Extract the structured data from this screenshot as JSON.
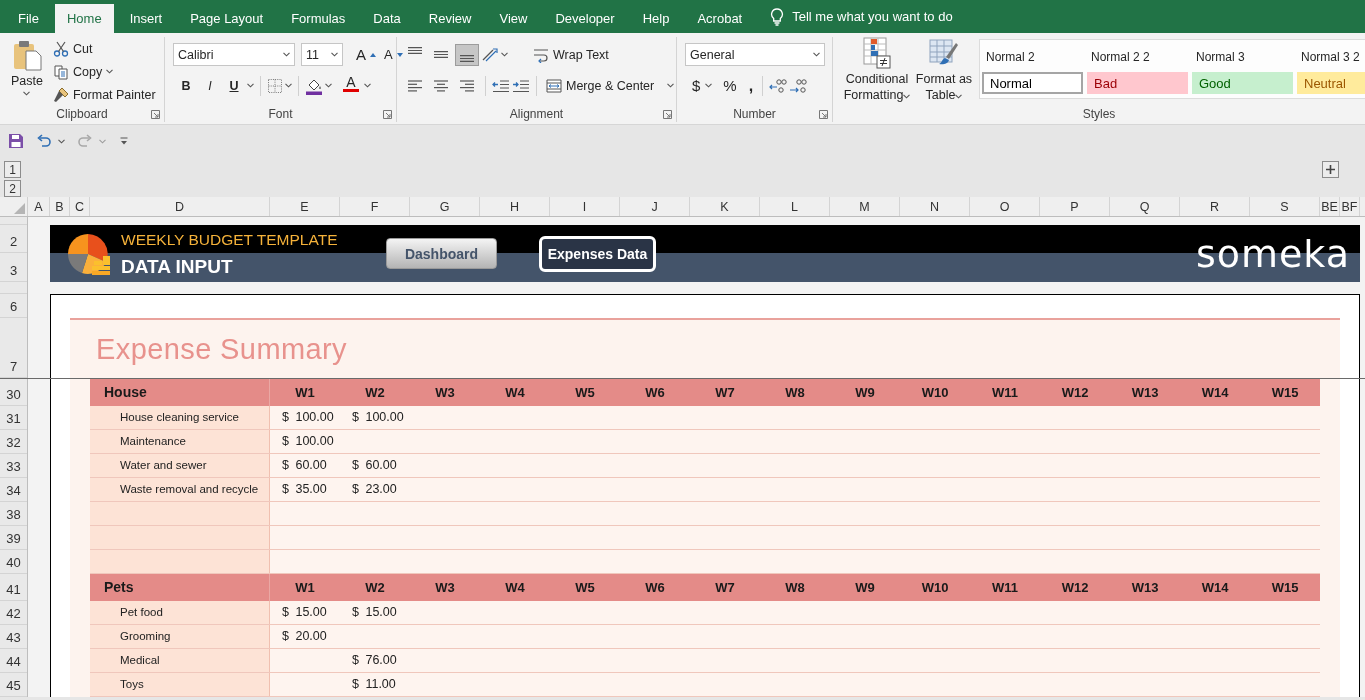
{
  "tabs": [
    {
      "label": "File",
      "selected": false
    },
    {
      "label": "Home",
      "selected": true
    },
    {
      "label": "Insert",
      "selected": false
    },
    {
      "label": "Page Layout",
      "selected": false
    },
    {
      "label": "Formulas",
      "selected": false
    },
    {
      "label": "Data",
      "selected": false
    },
    {
      "label": "Review",
      "selected": false
    },
    {
      "label": "View",
      "selected": false
    },
    {
      "label": "Developer",
      "selected": false
    },
    {
      "label": "Help",
      "selected": false
    },
    {
      "label": "Acrobat",
      "selected": false
    }
  ],
  "tell_me": {
    "placeholder": "Tell me what you want to do"
  },
  "clipboard": {
    "label": "Clipboard",
    "paste": "Paste",
    "cut": "Cut",
    "copy": "Copy",
    "format_painter": "Format Painter"
  },
  "font": {
    "label": "Font",
    "name": "Calibri",
    "size": "11",
    "grow": "A",
    "shrink": "A",
    "bold": "B",
    "italic": "I",
    "underline": "U",
    "font_color_button": "A"
  },
  "alignment": {
    "label": "Alignment",
    "vertical": [
      {
        "selected": false
      },
      {
        "selected": false
      },
      {
        "selected": true
      }
    ],
    "wrap_text": "Wrap Text",
    "merge_center": "Merge & Center"
  },
  "number": {
    "label": "Number",
    "format": "General",
    "currency": "$",
    "percent": "%",
    "comma": ","
  },
  "styles": {
    "label": "Styles",
    "conditional_formatting": "Conditional Formatting",
    "format_as_table": "Format as Table",
    "names": [
      "Normal 2",
      "Normal 2 2",
      "Normal 3",
      "Normal 3 2"
    ],
    "cells": [
      {
        "label": "Normal",
        "kind": "normal",
        "selected": true
      },
      {
        "label": "Bad",
        "kind": "bad",
        "selected": false
      },
      {
        "label": "Good",
        "kind": "good",
        "selected": false
      },
      {
        "label": "Neutral",
        "kind": "neutral",
        "selected": false
      }
    ]
  },
  "outline_levels": [
    "1",
    "2"
  ],
  "columns": [
    "A",
    "B",
    "C",
    "D",
    "E",
    "F",
    "G",
    "H",
    "I",
    "J",
    "K",
    "L",
    "M",
    "N",
    "O",
    "P",
    "Q",
    "R",
    "S",
    "BE",
    "BF"
  ],
  "rows": [
    "2",
    "3",
    "6",
    "7",
    "30",
    "31",
    "32",
    "33",
    "34",
    "38",
    "39",
    "40",
    "41",
    "42",
    "43",
    "44",
    "45"
  ],
  "banner": {
    "subtitle": "WEEKLY BUDGET TEMPLATE",
    "title": "DATA INPUT",
    "buttons": [
      {
        "label": "Dashboard",
        "selected": false
      },
      {
        "label": "Expenses Data",
        "selected": true
      }
    ],
    "brand": "someka"
  },
  "summary": {
    "title": "Expense Summary",
    "sections": [
      {
        "category": "House",
        "weeks": [
          "W1",
          "W2",
          "W3",
          "W4",
          "W5",
          "W6",
          "W7",
          "W8",
          "W9",
          "W10",
          "W11",
          "W12",
          "W13",
          "W14",
          "W15"
        ],
        "items": [
          {
            "kind": "item",
            "name": "House cleaning service",
            "values": [
              "$ 100.00",
              "$ 100.00"
            ]
          },
          {
            "kind": "item",
            "name": "Maintenance",
            "values": [
              "$ 100.00"
            ]
          },
          {
            "kind": "item",
            "name": "Water and sewer",
            "values": [
              "$ 60.00",
              "$ 60.00"
            ]
          },
          {
            "kind": "item",
            "name": "Waste removal and recycle",
            "values": [
              "$ 35.00",
              "$ 23.00"
            ]
          },
          {
            "kind": "blank"
          },
          {
            "kind": "blank"
          },
          {
            "kind": "blank"
          }
        ]
      },
      {
        "category": "Pets",
        "weeks": [
          "W1",
          "W2",
          "W3",
          "W4",
          "W5",
          "W6",
          "W7",
          "W8",
          "W9",
          "W10",
          "W11",
          "W12",
          "W13",
          "W14",
          "W15"
        ],
        "items": [
          {
            "kind": "item",
            "name": "Pet food",
            "values": [
              "$ 15.00",
              "$ 15.00"
            ]
          },
          {
            "kind": "item",
            "name": "Grooming",
            "values": [
              "$ 20.00"
            ]
          },
          {
            "kind": "item",
            "name": "Medical",
            "values": [
              {
                "kind": "empty"
              },
              {
                "kind": "amount",
                "text": "$ 76.00"
              }
            ]
          },
          {
            "kind": "item",
            "name": "Toys",
            "values": [
              {
                "kind": "empty"
              },
              {
                "kind": "amount",
                "text": "$ 11.00"
              }
            ]
          }
        ]
      }
    ]
  }
}
